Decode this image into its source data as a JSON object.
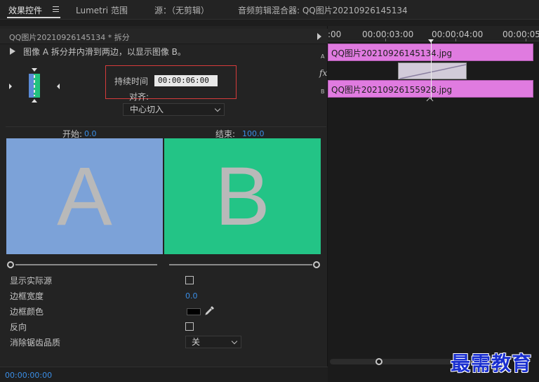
{
  "tabs": {
    "effect_controls": "效果控件",
    "lumetri": "Lumetri 范围",
    "source": "源：（无剪辑）",
    "audio_mixer": "音频剪辑混合器: QQ图片20210926145134"
  },
  "clip_header": {
    "title": "QQ图片20210926145134 * 拆分"
  },
  "effect": {
    "description": "图像 A 拆分并内滑到两边，以显示图像 B。",
    "duration_label": "持续时间",
    "duration_value": "00:00:06:00",
    "align_label": "对齐:",
    "align_value": "中心切入",
    "start_label": "开始:",
    "start_value": "0.0",
    "end_label": "结束:",
    "end_value": "100.0",
    "preview_a_letter": "A",
    "preview_b_letter": "B",
    "start_progress": 0.0,
    "end_progress": 1.0
  },
  "properties": {
    "show_actual_source": "显示实际源",
    "border_width": "边框宽度",
    "border_width_value": "0.0",
    "border_color": "边框颜色",
    "border_color_value": "#000000",
    "reverse": "反向",
    "anti_aliasing": "消除锯齿品质",
    "anti_aliasing_value": "关"
  },
  "status": {
    "timecode": "00:00:00:00"
  },
  "timeline": {
    "ruler_labels": [
      ":00",
      "00:00:03:00",
      "00:00:04:00",
      "00:00:05"
    ],
    "track_a": "A",
    "track_b": "B",
    "fx_label": "fx",
    "clip_a_name": "QQ图片20210926145134.jpg",
    "clip_b_name": "QQ图片20210926155928.jpg"
  },
  "watermark": "最需教育",
  "colors": {
    "accent_blue": "#3a8ee6",
    "highlight_red": "#d63b3b",
    "clip_pink": "#e07be0",
    "preview_a": "#7ca2d8",
    "preview_b": "#23c486"
  }
}
